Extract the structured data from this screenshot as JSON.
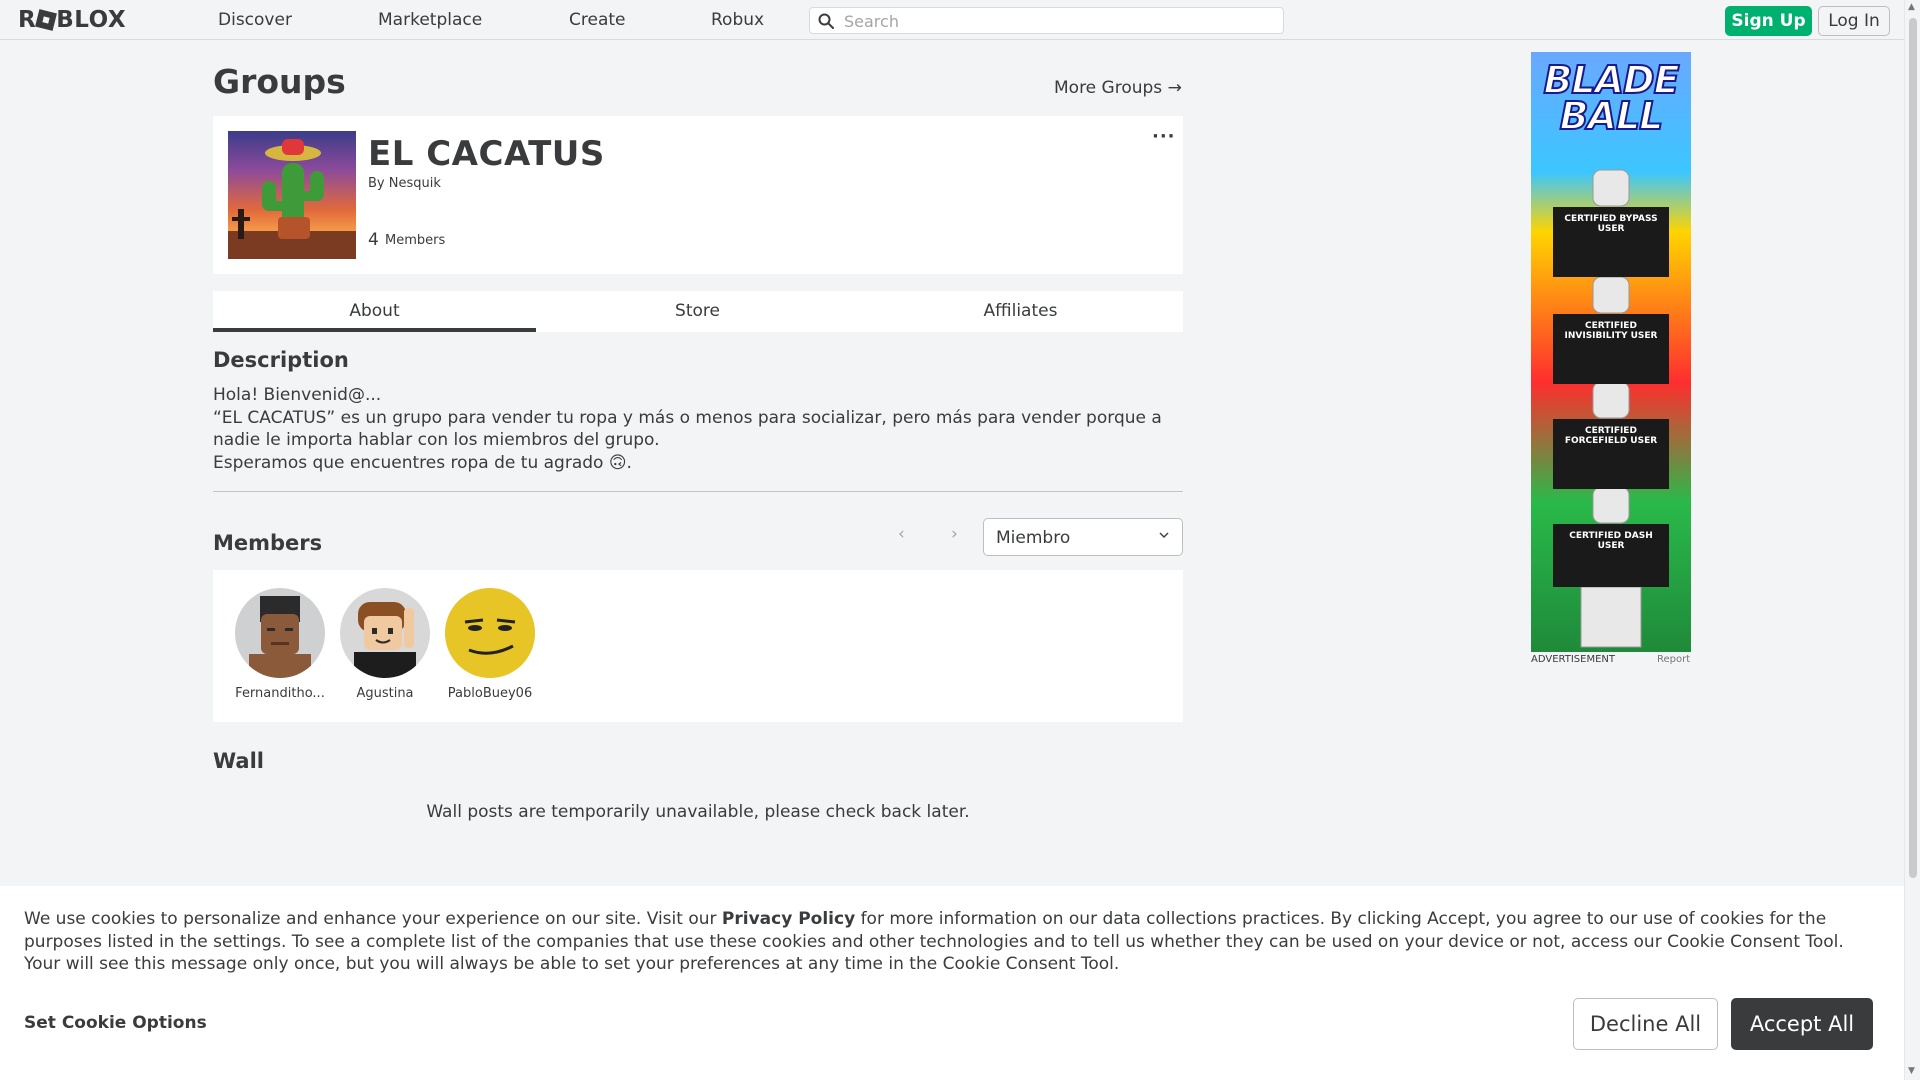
{
  "header": {
    "logo": "ROBLOX",
    "nav": [
      "Discover",
      "Marketplace",
      "Create",
      "Robux"
    ],
    "search_placeholder": "Search",
    "signup_label": "Sign Up",
    "login_label": "Log In"
  },
  "page": {
    "title": "Groups",
    "more_groups": "More Groups →"
  },
  "group": {
    "name": "EL CACATUS",
    "by_prefix": "By",
    "owner": "Nesquik",
    "member_count": "4",
    "member_count_label": "Members",
    "menu_icon": "more-dots-icon"
  },
  "tabs": [
    "About",
    "Store",
    "Affiliates"
  ],
  "active_tab": "About",
  "description": {
    "heading": "Description",
    "lines": [
      "Hola! Bienvenid@...",
      "“EL CACATUS” es un grupo para vender tu ropa y más o menos para socializar, pero más para vender porque a",
      "nadie le importa hablar con los miembros del grupo.",
      "Esperamos que encuentres ropa de tu agrado 🙃."
    ]
  },
  "members": {
    "heading": "Members",
    "role_selected": "Miembro",
    "list": [
      {
        "name": "Fernanditho..."
      },
      {
        "name": "Agustina"
      },
      {
        "name": "PabloBuey06"
      }
    ]
  },
  "wall": {
    "heading": "Wall",
    "message": "Wall posts are temporarily unavailable, please check back later."
  },
  "ad": {
    "title": "BLADE BALL",
    "label": "ADVERTISEMENT",
    "report": "Report",
    "shirt_texts": [
      "CERTIFIED BYPASS USER",
      "CERTIFIED INVISIBILITY USER",
      "CERTIFIED FORCEFIELD USER",
      "CERTIFIED DASH USER"
    ]
  },
  "cookie": {
    "text_before": "We use cookies to personalize and enhance your experience on our site. Visit our ",
    "privacy_link": "Privacy Policy",
    "text_after": " for more information on our data collections practices. By clicking Accept, you agree to our use of cookies for the purposes listed in the settings. To see a complete list of the companies that use these cookies and other technologies and to tell us whether they can be used on your device or not, access our Cookie Consent Tool. Your will see this message only once, but you will always be able to set your preferences at any time in the Cookie Consent Tool.",
    "options_label": "Set Cookie Options",
    "decline_label": "Decline All",
    "accept_label": "Accept All"
  },
  "colors": {
    "background": "#f2f4f5",
    "text": "#393b3d",
    "signup_green": "#00b06f",
    "accept_dark": "#393b3d"
  }
}
